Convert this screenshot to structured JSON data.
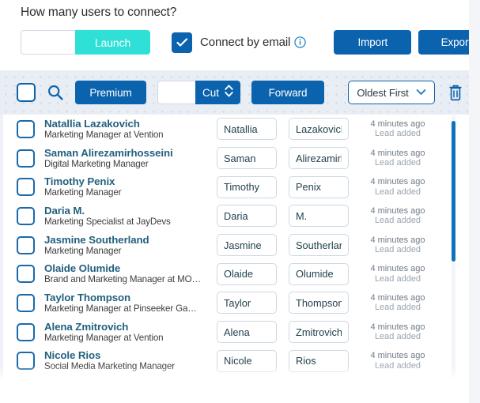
{
  "header": {
    "title": "How many users to connect?",
    "count_input_value": "",
    "count_input_placeholder": "",
    "launch_label": "Launch",
    "connect_by_email_label": "Connect by email",
    "connect_by_email_checked": true,
    "info_icon": "info-circle-icon",
    "import_label": "Import",
    "export_label": "Export"
  },
  "toolbar": {
    "select_all_checked": false,
    "search_icon": "search-icon",
    "premium_label": "Premium",
    "cut_input_value": "",
    "cut_label": "Cut",
    "stepper_icon": "chevron-up-down-icon",
    "forward_label": "Forward",
    "sort_value": "Oldest First",
    "sort_chevron_icon": "chevron-down-icon",
    "delete_icon": "trash-icon"
  },
  "colors": {
    "primary_blue": "#0b63ae",
    "launch_teal": "#2ee0d6",
    "name_link": "#22607d",
    "scrollbar": "#0f72bd",
    "toolbar_bg": "#e9edf4"
  },
  "list": {
    "scroll_position_percent": 2,
    "rows": [
      {
        "name": "Natallia Lazakovich",
        "subtitle": "Marketing Manager at Vention",
        "first_name": "Natallia",
        "last_name": "Lazakovich",
        "time": "4 minutes ago",
        "status": "Lead added",
        "checked": false
      },
      {
        "name": "Saman Alirezamirhosseini",
        "subtitle": "Digital Marketing Manager",
        "first_name": "Saman",
        "last_name": "Alirezamirhosseini",
        "time": "4 minutes ago",
        "status": "Lead added",
        "checked": false
      },
      {
        "name": "Timothy Penix",
        "subtitle": "Marketing Manager",
        "first_name": "Timothy",
        "last_name": "Penix",
        "time": "4 minutes ago",
        "status": "Lead added",
        "checked": false
      },
      {
        "name": "Daria M.",
        "subtitle": "Marketing Specialist at JayDevs",
        "first_name": "Daria",
        "last_name": "M.",
        "time": "4 minutes ago",
        "status": "Lead added",
        "checked": false
      },
      {
        "name": "Jasmine Southerland",
        "subtitle": "Marketing Manager",
        "first_name": "Jasmine",
        "last_name": "Southerland",
        "time": "4 minutes ago",
        "status": "Lead added",
        "checked": false
      },
      {
        "name": "Olaide Olumide",
        "subtitle": "Brand and Marketing Manager at MO…",
        "first_name": "Olaide",
        "last_name": "Olumide",
        "time": "4 minutes ago",
        "status": "Lead added",
        "checked": false
      },
      {
        "name": "Taylor Thompson",
        "subtitle": "Marketing Manager at Pinseeker Ga…",
        "first_name": "Taylor",
        "last_name": "Thompson",
        "time": "4 minutes ago",
        "status": "Lead added",
        "checked": false
      },
      {
        "name": "Alena Zmitrovich",
        "subtitle": "Marketing Manager at Vention",
        "first_name": "Alena",
        "last_name": "Zmitrovich",
        "time": "4 minutes ago",
        "status": "Lead added",
        "checked": false
      },
      {
        "name": "Nicole Rios",
        "subtitle": "Social Media Marketing Manager",
        "first_name": "Nicole",
        "last_name": "Rios",
        "time": "4 minutes ago",
        "status": "Lead added",
        "checked": false
      }
    ]
  }
}
